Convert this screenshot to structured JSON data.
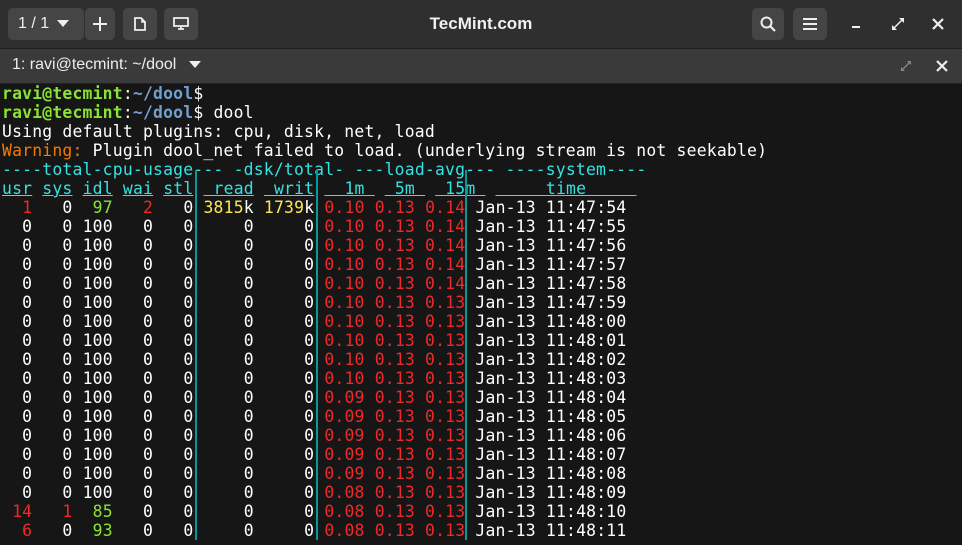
{
  "window": {
    "title": "TecMint.com",
    "tab_selector": "1 / 1",
    "tab_title": "1: ravi@tecmint: ~/dool"
  },
  "prompt": {
    "user_host": "ravi@tecmint",
    "sep": ":",
    "path": "~/dool",
    "dollar": "$",
    "command": " dool"
  },
  "messages": {
    "plugins": "Using default plugins: cpu, disk, net, load",
    "warning_label": "Warning:",
    "warning_text": " Plugin dool_net failed to load. (underlying stream is not seekable)"
  },
  "groups": {
    "cpu": "----total-cpu-usage---",
    "dsk": "-dsk/total-",
    "load": "---load-avg---",
    "system": "----system----"
  },
  "columns": [
    "usr",
    "sys",
    "idl",
    "wai",
    "stl",
    "read",
    "writ",
    "1m",
    "5m",
    "15m",
    "time"
  ],
  "rows": [
    {
      "usr": "1",
      "sys": "0",
      "idl": "97",
      "wai": "2",
      "stl": "0",
      "read": "3815",
      "read_unit": "k",
      "writ": "1739",
      "writ_unit": "k",
      "l1": "0.10",
      "l5": "0.13",
      "l15": "0.14",
      "time": "Jan-13 11:47:54"
    },
    {
      "usr": "0",
      "sys": "0",
      "idl": "100",
      "wai": "0",
      "stl": "0",
      "read": "0",
      "read_unit": "",
      "writ": "0",
      "writ_unit": "",
      "l1": "0.10",
      "l5": "0.13",
      "l15": "0.14",
      "time": "Jan-13 11:47:55"
    },
    {
      "usr": "0",
      "sys": "0",
      "idl": "100",
      "wai": "0",
      "stl": "0",
      "read": "0",
      "read_unit": "",
      "writ": "0",
      "writ_unit": "",
      "l1": "0.10",
      "l5": "0.13",
      "l15": "0.14",
      "time": "Jan-13 11:47:56"
    },
    {
      "usr": "0",
      "sys": "0",
      "idl": "100",
      "wai": "0",
      "stl": "0",
      "read": "0",
      "read_unit": "",
      "writ": "0",
      "writ_unit": "",
      "l1": "0.10",
      "l5": "0.13",
      "l15": "0.14",
      "time": "Jan-13 11:47:57"
    },
    {
      "usr": "0",
      "sys": "0",
      "idl": "100",
      "wai": "0",
      "stl": "0",
      "read": "0",
      "read_unit": "",
      "writ": "0",
      "writ_unit": "",
      "l1": "0.10",
      "l5": "0.13",
      "l15": "0.14",
      "time": "Jan-13 11:47:58"
    },
    {
      "usr": "0",
      "sys": "0",
      "idl": "100",
      "wai": "0",
      "stl": "0",
      "read": "0",
      "read_unit": "",
      "writ": "0",
      "writ_unit": "",
      "l1": "0.10",
      "l5": "0.13",
      "l15": "0.13",
      "time": "Jan-13 11:47:59"
    },
    {
      "usr": "0",
      "sys": "0",
      "idl": "100",
      "wai": "0",
      "stl": "0",
      "read": "0",
      "read_unit": "",
      "writ": "0",
      "writ_unit": "",
      "l1": "0.10",
      "l5": "0.13",
      "l15": "0.13",
      "time": "Jan-13 11:48:00"
    },
    {
      "usr": "0",
      "sys": "0",
      "idl": "100",
      "wai": "0",
      "stl": "0",
      "read": "0",
      "read_unit": "",
      "writ": "0",
      "writ_unit": "",
      "l1": "0.10",
      "l5": "0.13",
      "l15": "0.13",
      "time": "Jan-13 11:48:01"
    },
    {
      "usr": "0",
      "sys": "0",
      "idl": "100",
      "wai": "0",
      "stl": "0",
      "read": "0",
      "read_unit": "",
      "writ": "0",
      "writ_unit": "",
      "l1": "0.10",
      "l5": "0.13",
      "l15": "0.13",
      "time": "Jan-13 11:48:02"
    },
    {
      "usr": "0",
      "sys": "0",
      "idl": "100",
      "wai": "0",
      "stl": "0",
      "read": "0",
      "read_unit": "",
      "writ": "0",
      "writ_unit": "",
      "l1": "0.10",
      "l5": "0.13",
      "l15": "0.13",
      "time": "Jan-13 11:48:03"
    },
    {
      "usr": "0",
      "sys": "0",
      "idl": "100",
      "wai": "0",
      "stl": "0",
      "read": "0",
      "read_unit": "",
      "writ": "0",
      "writ_unit": "",
      "l1": "0.09",
      "l5": "0.13",
      "l15": "0.13",
      "time": "Jan-13 11:48:04"
    },
    {
      "usr": "0",
      "sys": "0",
      "idl": "100",
      "wai": "0",
      "stl": "0",
      "read": "0",
      "read_unit": "",
      "writ": "0",
      "writ_unit": "",
      "l1": "0.09",
      "l5": "0.13",
      "l15": "0.13",
      "time": "Jan-13 11:48:05"
    },
    {
      "usr": "0",
      "sys": "0",
      "idl": "100",
      "wai": "0",
      "stl": "0",
      "read": "0",
      "read_unit": "",
      "writ": "0",
      "writ_unit": "",
      "l1": "0.09",
      "l5": "0.13",
      "l15": "0.13",
      "time": "Jan-13 11:48:06"
    },
    {
      "usr": "0",
      "sys": "0",
      "idl": "100",
      "wai": "0",
      "stl": "0",
      "read": "0",
      "read_unit": "",
      "writ": "0",
      "writ_unit": "",
      "l1": "0.09",
      "l5": "0.13",
      "l15": "0.13",
      "time": "Jan-13 11:48:07"
    },
    {
      "usr": "0",
      "sys": "0",
      "idl": "100",
      "wai": "0",
      "stl": "0",
      "read": "0",
      "read_unit": "",
      "writ": "0",
      "writ_unit": "",
      "l1": "0.09",
      "l5": "0.13",
      "l15": "0.13",
      "time": "Jan-13 11:48:08"
    },
    {
      "usr": "0",
      "sys": "0",
      "idl": "100",
      "wai": "0",
      "stl": "0",
      "read": "0",
      "read_unit": "",
      "writ": "0",
      "writ_unit": "",
      "l1": "0.08",
      "l5": "0.13",
      "l15": "0.13",
      "time": "Jan-13 11:48:09"
    },
    {
      "usr": "14",
      "sys": "1",
      "idl": "85",
      "wai": "0",
      "stl": "0",
      "read": "0",
      "read_unit": "",
      "writ": "0",
      "writ_unit": "",
      "l1": "0.08",
      "l5": "0.13",
      "l15": "0.13",
      "time": "Jan-13 11:48:10"
    },
    {
      "usr": "6",
      "sys": "0",
      "idl": "93",
      "wai": "0",
      "stl": "0",
      "read": "0",
      "read_unit": "",
      "writ": "0",
      "writ_unit": "",
      "l1": "0.08",
      "l5": "0.13",
      "l15": "0.13",
      "time": "Jan-13 11:48:11"
    }
  ],
  "icons": [
    "chevron-down-icon",
    "plus-icon",
    "split-icon",
    "attach-icon",
    "search-icon",
    "hamburger-menu-icon",
    "minimize-icon",
    "maximize-icon",
    "close-icon",
    "detach-tab-icon",
    "tab-close-icon"
  ],
  "colors": {
    "user_host": "#8ae234",
    "path": "#729fcf",
    "warning": "#f57900",
    "header": "#34e2e2",
    "load": "#ef2929"
  }
}
